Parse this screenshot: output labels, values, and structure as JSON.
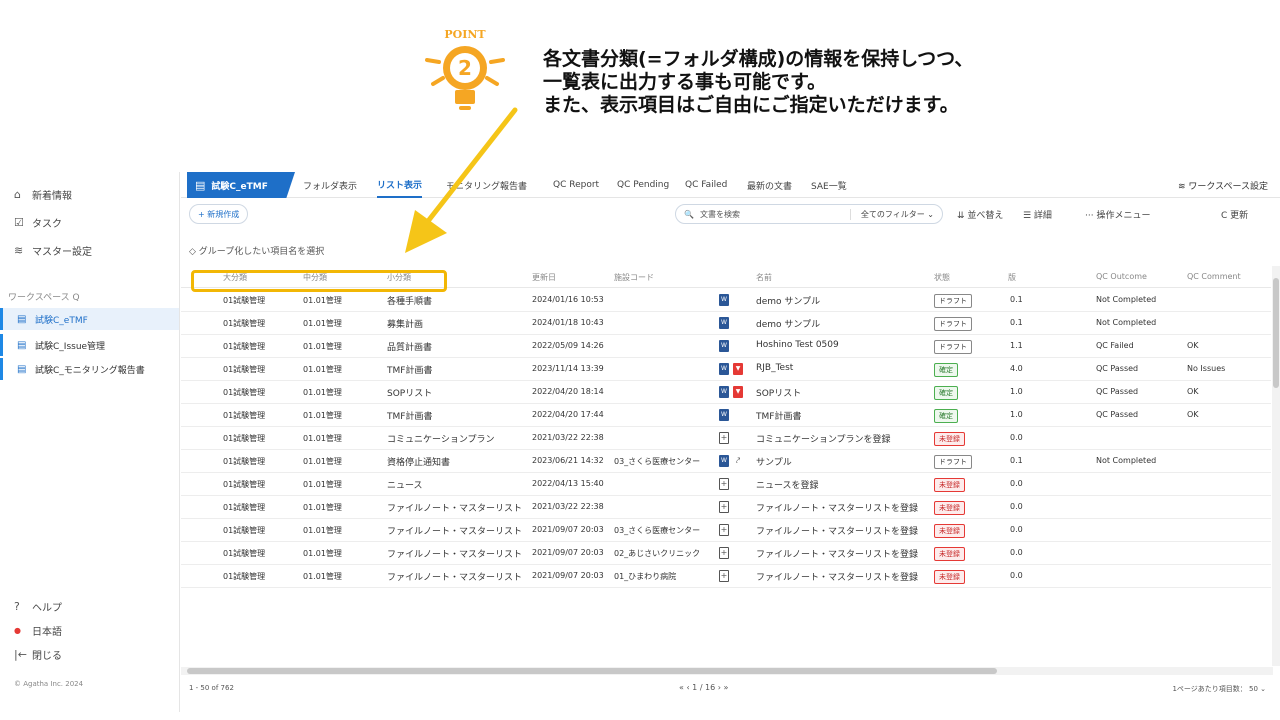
{
  "banner": {
    "point_label": "POINT",
    "point_number": "2",
    "lines": [
      "各文書分類(=フォルダ構成)の情報を保持しつつ、",
      "一覧表に出力する事も可能です。",
      "また、表示項目はご自由にご指定いただけます。"
    ]
  },
  "sidebar": {
    "items": [
      {
        "icon": "news-icon",
        "glyph": "⌂",
        "label": "新着情報"
      },
      {
        "icon": "task-icon",
        "glyph": "☑",
        "label": "タスク"
      },
      {
        "icon": "settings-icon",
        "glyph": "≋",
        "label": "マスター設定"
      }
    ],
    "workspace_label": "ワークスペース  Q",
    "workspaces": [
      {
        "label": "試験C_eTMF",
        "active": true
      },
      {
        "label": "試験C_Issue管理",
        "active": false
      },
      {
        "label": "試験C_モニタリング報告書",
        "active": false
      }
    ],
    "bottom": [
      {
        "icon": "help-icon",
        "glyph": "?",
        "label": "ヘルプ"
      },
      {
        "icon": "language-icon",
        "glyph": "●",
        "label": "日本語"
      },
      {
        "icon": "collapse-icon",
        "glyph": "|←",
        "label": "閉じる"
      }
    ],
    "copyright": "© Agatha Inc. 2024"
  },
  "tabs": {
    "brand": "試験C_eTMF",
    "items": [
      "フォルダ表示",
      "リスト表示",
      "モニタリング報告書",
      "QC Report",
      "QC Pending",
      "QC Failed",
      "最新の文書",
      "SAE一覧"
    ],
    "active_index": 1,
    "workspace_settings": "ワークスペース設定"
  },
  "toolbar": {
    "new": "+ 新規作成",
    "search_placeholder": "文書を検索",
    "filter": "全てのフィルター ⌄",
    "sort": "⇊ 並べ替え",
    "detail": "☰ 詳細",
    "menu": "··· 操作メニュー",
    "refresh": "C 更新"
  },
  "group_prompt": "グループ化したい項目名を選択",
  "columns": [
    "大分類",
    "中分類",
    "小分類",
    "更新日",
    "施設コード",
    "名前",
    "状態",
    "版",
    "QC Outcome",
    "QC Comment"
  ],
  "rows": [
    {
      "c1": "01試験管理",
      "c2": "01.01管理",
      "c3": "各種手順書",
      "date": "2024/01/16 10:53",
      "site": "",
      "icons": [
        "word"
      ],
      "name": "demo サンプル",
      "status": "ドラフト",
      "stype": "draft",
      "ver": "0.1",
      "qc": "Not Completed",
      "comment": ""
    },
    {
      "c1": "01試験管理",
      "c2": "01.01管理",
      "c3": "募集計画",
      "date": "2024/01/18 10:43",
      "site": "",
      "icons": [
        "word"
      ],
      "name": "demo サンプル",
      "status": "ドラフト",
      "stype": "draft",
      "ver": "0.1",
      "qc": "Not Completed",
      "comment": ""
    },
    {
      "c1": "01試験管理",
      "c2": "01.01管理",
      "c3": "品質計画書",
      "date": "2022/05/09 14:26",
      "site": "",
      "icons": [
        "word"
      ],
      "name": "Hoshino Test 0509",
      "status": "ドラフト",
      "stype": "draft",
      "ver": "1.1",
      "qc": "QC Failed",
      "comment": "OK"
    },
    {
      "c1": "01試験管理",
      "c2": "01.01管理",
      "c3": "TMF計画書",
      "date": "2023/11/14 13:39",
      "site": "",
      "icons": [
        "word",
        "pdf"
      ],
      "name": "RJB_Test",
      "status": "確定",
      "stype": "ok",
      "ver": "4.0",
      "qc": "QC Passed",
      "comment": "No Issues"
    },
    {
      "c1": "01試験管理",
      "c2": "01.01管理",
      "c3": "SOPリスト",
      "date": "2022/04/20 18:14",
      "site": "",
      "icons": [
        "word",
        "pdf"
      ],
      "name": "SOPリスト",
      "status": "確定",
      "stype": "ok",
      "ver": "1.0",
      "qc": "QC Passed",
      "comment": "OK"
    },
    {
      "c1": "01試験管理",
      "c2": "01.01管理",
      "c3": "TMF計画書",
      "date": "2022/04/20 17:44",
      "site": "",
      "icons": [
        "word"
      ],
      "name": "TMF計画書",
      "status": "確定",
      "stype": "ok",
      "ver": "1.0",
      "qc": "QC Passed",
      "comment": "OK"
    },
    {
      "c1": "01試験管理",
      "c2": "01.01管理",
      "c3": "コミュニケーションプラン",
      "date": "2021/03/22 22:38",
      "site": "",
      "icons": [
        "add"
      ],
      "name": "コミュニケーションプランを登録",
      "status": "未登録",
      "stype": "ng",
      "ver": "0.0",
      "qc": "",
      "comment": ""
    },
    {
      "c1": "01試験管理",
      "c2": "01.01管理",
      "c3": "資格停止通知書",
      "date": "2023/06/21 14:32",
      "site": "03_さくら医療センター",
      "icons": [
        "word",
        "link"
      ],
      "name": "サンプル",
      "status": "ドラフト",
      "stype": "draft",
      "ver": "0.1",
      "qc": "Not Completed",
      "comment": ""
    },
    {
      "c1": "01試験管理",
      "c2": "01.01管理",
      "c3": "ニュース",
      "date": "2022/04/13 15:40",
      "site": "",
      "icons": [
        "add"
      ],
      "name": "ニュースを登録",
      "status": "未登録",
      "stype": "ng",
      "ver": "0.0",
      "qc": "",
      "comment": ""
    },
    {
      "c1": "01試験管理",
      "c2": "01.01管理",
      "c3": "ファイルノート・マスターリスト",
      "date": "2021/03/22 22:38",
      "site": "",
      "icons": [
        "add"
      ],
      "name": "ファイルノート・マスターリストを登録",
      "status": "未登録",
      "stype": "ng",
      "ver": "0.0",
      "qc": "",
      "comment": ""
    },
    {
      "c1": "01試験管理",
      "c2": "01.01管理",
      "c3": "ファイルノート・マスターリスト",
      "date": "2021/09/07 20:03",
      "site": "03_さくら医療センター",
      "icons": [
        "add"
      ],
      "name": "ファイルノート・マスターリストを登録",
      "status": "未登録",
      "stype": "ng",
      "ver": "0.0",
      "qc": "",
      "comment": ""
    },
    {
      "c1": "01試験管理",
      "c2": "01.01管理",
      "c3": "ファイルノート・マスターリスト",
      "date": "2021/09/07 20:03",
      "site": "02_あじさいクリニック",
      "icons": [
        "add"
      ],
      "name": "ファイルノート・マスターリストを登録",
      "status": "未登録",
      "stype": "ng",
      "ver": "0.0",
      "qc": "",
      "comment": ""
    },
    {
      "c1": "01試験管理",
      "c2": "01.01管理",
      "c3": "ファイルノート・マスターリスト",
      "date": "2021/09/07 20:03",
      "site": "01_ひまわり病院",
      "icons": [
        "add"
      ],
      "name": "ファイルノート・マスターリストを登録",
      "status": "未登録",
      "stype": "ng",
      "ver": "0.0",
      "qc": "",
      "comment": ""
    }
  ],
  "footer": {
    "count": "1 - 50 of 762",
    "pager": "«  ‹  1 / 16  ›  »",
    "per_page": "1ページあたり項目数：  50  ⌄"
  },
  "colors": {
    "accent": "#1e6fc8",
    "highlight": "#f2b705",
    "arrow": "#f5c518"
  }
}
